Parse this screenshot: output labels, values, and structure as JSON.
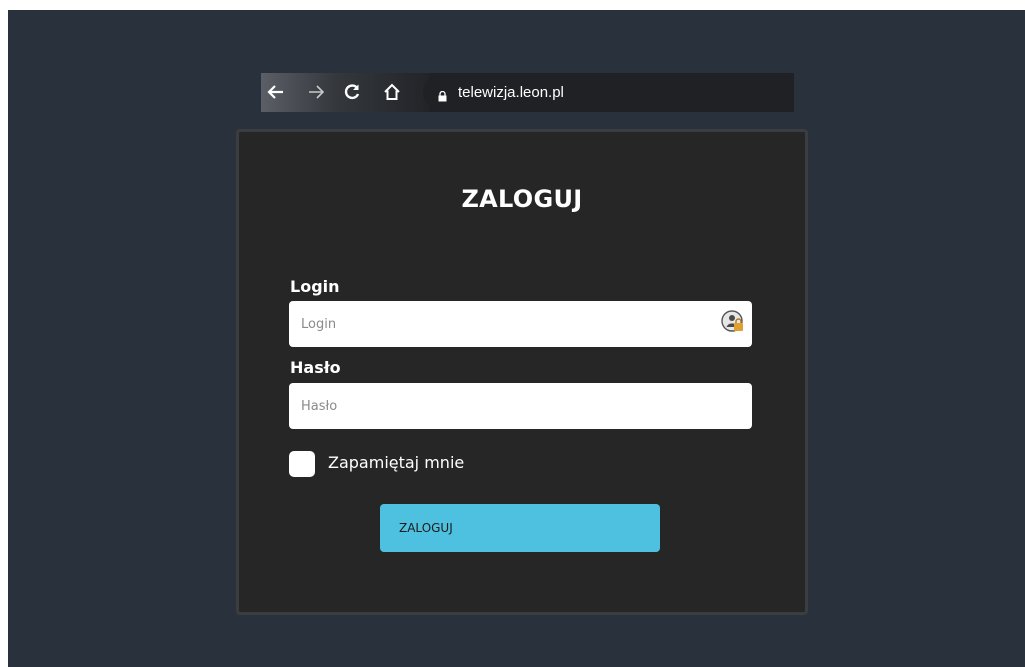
{
  "browser": {
    "url": "telewizja.leon.pl",
    "back_icon": "arrow-left-icon",
    "forward_icon": "arrow-right-icon",
    "reload_icon": "reload-icon",
    "home_icon": "home-icon",
    "lock_icon": "lock-icon"
  },
  "login_form": {
    "title": "ZALOGUJ",
    "login_label": "Login",
    "login_placeholder": "Login",
    "login_value": "",
    "password_label": "Hasło",
    "password_placeholder": "Hasło",
    "password_value": "",
    "remember_label": "Zapamiętaj mnie",
    "remember_checked": false,
    "submit_label": "ZALOGUJ",
    "password_manager_icon": "password-manager-icon"
  },
  "colors": {
    "background": "#29323c",
    "panel": "#262626",
    "button": "#4fc1e0"
  }
}
